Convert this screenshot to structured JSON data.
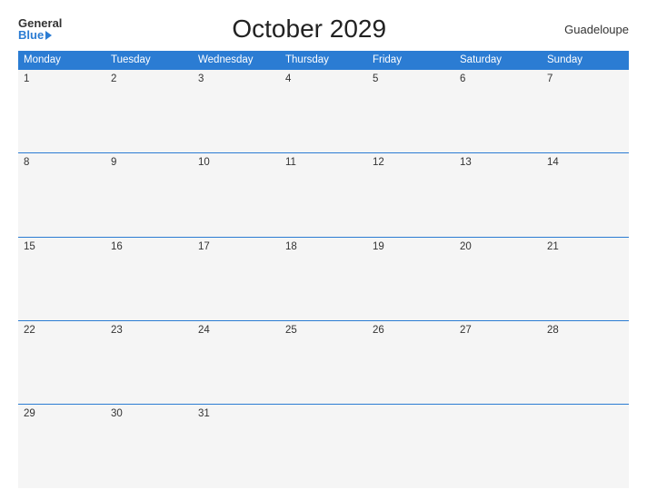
{
  "header": {
    "logo_general": "General",
    "logo_blue": "Blue",
    "title": "October 2029",
    "region": "Guadeloupe"
  },
  "weekdays": [
    "Monday",
    "Tuesday",
    "Wednesday",
    "Thursday",
    "Friday",
    "Saturday",
    "Sunday"
  ],
  "weeks": [
    [
      1,
      2,
      3,
      4,
      5,
      6,
      7
    ],
    [
      8,
      9,
      10,
      11,
      12,
      13,
      14
    ],
    [
      15,
      16,
      17,
      18,
      19,
      20,
      21
    ],
    [
      22,
      23,
      24,
      25,
      26,
      27,
      28
    ],
    [
      29,
      30,
      31,
      null,
      null,
      null,
      null
    ]
  ]
}
